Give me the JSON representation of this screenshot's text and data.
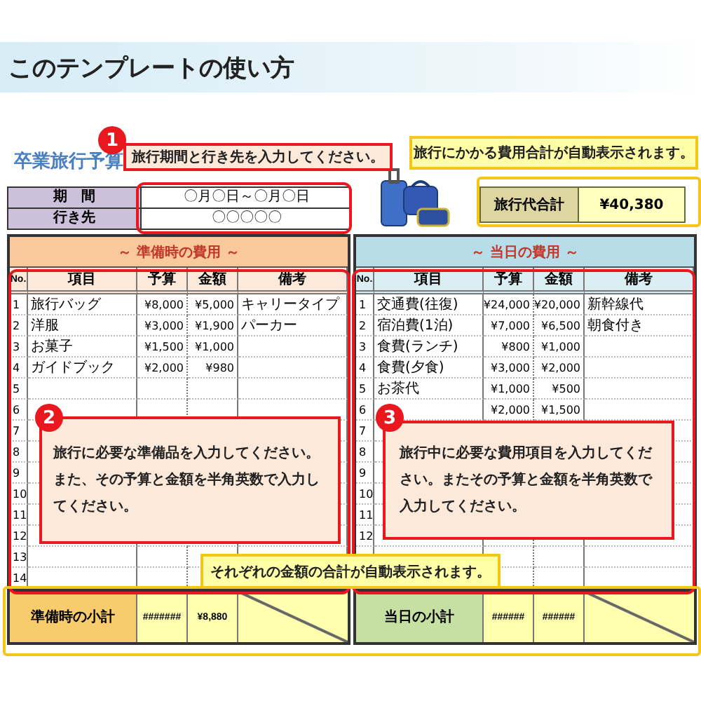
{
  "header": {
    "title": "このテンプレートの使い方"
  },
  "sheet": {
    "title": "卒業旅行予算",
    "info": [
      {
        "label": "期　間",
        "value": "〇月〇日～〇月〇日"
      },
      {
        "label": "行き先",
        "value": "〇〇〇〇〇"
      }
    ],
    "total": {
      "label": "旅行代合計",
      "value": "¥40,380"
    },
    "panels": [
      {
        "kind": "prep",
        "title": "～ 準備時の費用 ～",
        "columns": [
          "No.",
          "項目",
          "予算",
          "金額",
          "備考"
        ],
        "rows": [
          {
            "no": "1",
            "item": "旅行バッグ",
            "budget": "¥8,000",
            "amount": "¥5,000",
            "note": "キャリータイプ"
          },
          {
            "no": "2",
            "item": "洋服",
            "budget": "¥3,000",
            "amount": "¥1,900",
            "note": "パーカー"
          },
          {
            "no": "3",
            "item": "お菓子",
            "budget": "¥1,500",
            "amount": "¥1,000"
          },
          {
            "no": "4",
            "item": "ガイドブック",
            "budget": "¥2,000",
            "amount": "¥980"
          },
          {
            "no": "5"
          },
          {
            "no": "6"
          },
          {
            "no": "7"
          },
          {
            "no": "8"
          },
          {
            "no": "9"
          },
          {
            "no": "10"
          },
          {
            "no": "11"
          },
          {
            "no": "12"
          },
          {
            "no": "13"
          },
          {
            "no": "14"
          }
        ],
        "subtotal": {
          "label": "準備時の小計",
          "budget": "#######",
          "amount": "¥8,880"
        }
      },
      {
        "kind": "day",
        "title": "～ 当日の費用 ～",
        "columns": [
          "No.",
          "項目",
          "予算",
          "金額",
          "備考"
        ],
        "rows": [
          {
            "no": "1",
            "item": "交通費(往復)",
            "budget": "¥24,000",
            "amount": "¥20,000",
            "note": "新幹線代"
          },
          {
            "no": "2",
            "item": "宿泊費(1泊)",
            "budget": "¥7,000",
            "amount": "¥6,500",
            "note": "朝食付き"
          },
          {
            "no": "3",
            "item": "食費(ランチ)",
            "budget": "¥800",
            "amount": "¥1,000"
          },
          {
            "no": "4",
            "item": "食費(夕食)",
            "budget": "¥3,000",
            "amount": "¥2,000"
          },
          {
            "no": "5",
            "item": "お茶代",
            "budget": "¥1,000",
            "amount": "¥500"
          },
          {
            "no": "6",
            "budget": "¥2,000",
            "amount": "¥1,500"
          },
          {
            "no": "7"
          },
          {
            "no": "8"
          },
          {
            "no": "9"
          },
          {
            "no": "10"
          },
          {
            "no": "11"
          },
          {
            "no": "12"
          },
          {},
          {}
        ],
        "subtotal": {
          "label": "当日の小計",
          "budget": "######",
          "amount": "######"
        }
      }
    ]
  },
  "callouts": [
    {
      "kind": "step",
      "number": "1",
      "text": "旅行期間と行き先を入力してください。"
    },
    {
      "kind": "note",
      "text": "旅行にかかる費用合計が自動表示されます。"
    },
    {
      "kind": "step",
      "number": "2",
      "text": "旅行に必要な準備品を入力してください。また、その予算と金額を半角英数で入力してください。"
    },
    {
      "kind": "step",
      "number": "3",
      "text": "旅行中に必要な費用項目を入力してください。またその予算と金額を半角英数で入力してください。"
    },
    {
      "kind": "note",
      "text": "それぞれの金額の合計が自動表示されます。"
    }
  ]
}
